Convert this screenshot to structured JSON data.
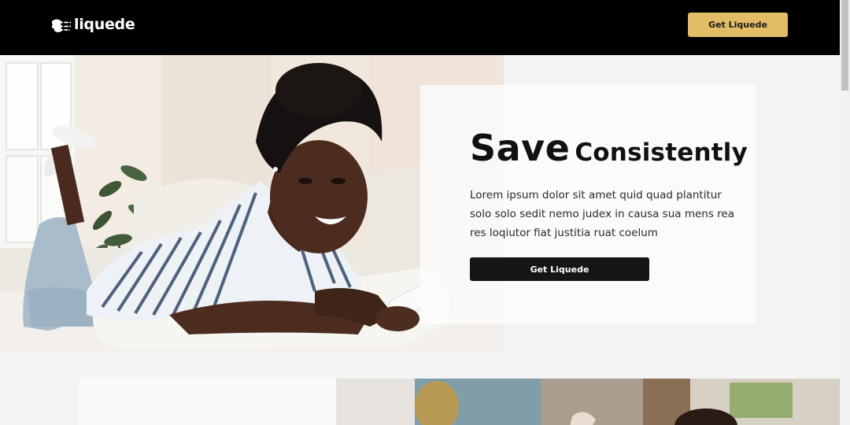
{
  "header": {
    "brand": "liquede",
    "cta_label": "Get Liquede"
  },
  "hero": {
    "title_bold": "Save",
    "title_light": "Consistently",
    "body_lines": [
      "Lorem ipsum dolor sit amet quid quad plantitur",
      "solo solo sedit nemo judex in causa sua mens rea",
      "res loqiutor fiat justitia ruat coelum"
    ],
    "cta_label": "Get Liquede",
    "photo_alt": "young woman lying on a sofa smiling at her phone"
  },
  "section_two": {
    "photo_alt": "family photo"
  },
  "colors": {
    "nav_background": "#000000",
    "accent_gold": "#e2bd66",
    "dark_button": "#161616",
    "page_background": "#f4f4f4"
  },
  "icons": {
    "logo": "wave-logo-icon"
  }
}
